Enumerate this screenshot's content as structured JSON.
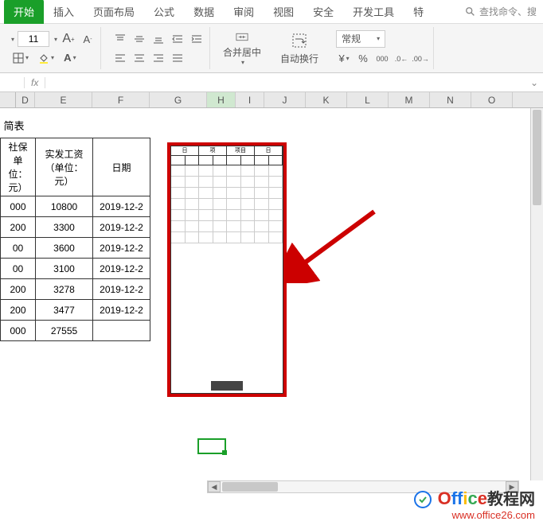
{
  "ribbon": {
    "tabs": [
      "开始",
      "插入",
      "页面布局",
      "公式",
      "数据",
      "审阅",
      "视图",
      "安全",
      "开发工具",
      "特"
    ],
    "active_tab": "开始",
    "search_placeholder": "查找命令、搜"
  },
  "toolbar": {
    "font_size": "11",
    "merge_label": "合并居中",
    "wrap_label": "自动换行",
    "format_label": "常规",
    "percent_symbol": "%",
    "increase_font": "A",
    "decrease_font": "A"
  },
  "formula_bar": {
    "fx": "fx",
    "value": ""
  },
  "columns": [
    "D",
    "E",
    "F",
    "G",
    "H",
    "I",
    "J",
    "K",
    "L",
    "M",
    "N",
    "O"
  ],
  "active_column": "H",
  "sheet": {
    "title": "简表",
    "headers": [
      "社保\n单位：\n元）",
      "实发工资\n（单位：\n元）",
      "日期"
    ],
    "rows": [
      {
        "c1": "000",
        "c2": "10800",
        "c3": "2019-12-2"
      },
      {
        "c1": "200",
        "c2": "3300",
        "c3": "2019-12-2"
      },
      {
        "c1": "00",
        "c2": "3600",
        "c3": "2019-12-2"
      },
      {
        "c1": "00",
        "c2": "3100",
        "c3": "2019-12-2"
      },
      {
        "c1": "200",
        "c2": "3278",
        "c3": "2019-12-2"
      },
      {
        "c1": "200",
        "c2": "3477",
        "c3": "2019-12-2"
      },
      {
        "c1": "000",
        "c2": "27555",
        "c3": ""
      }
    ]
  },
  "watermark": {
    "brand_office": "Office",
    "brand_cn": "教程网",
    "url": "www.office26.com"
  }
}
